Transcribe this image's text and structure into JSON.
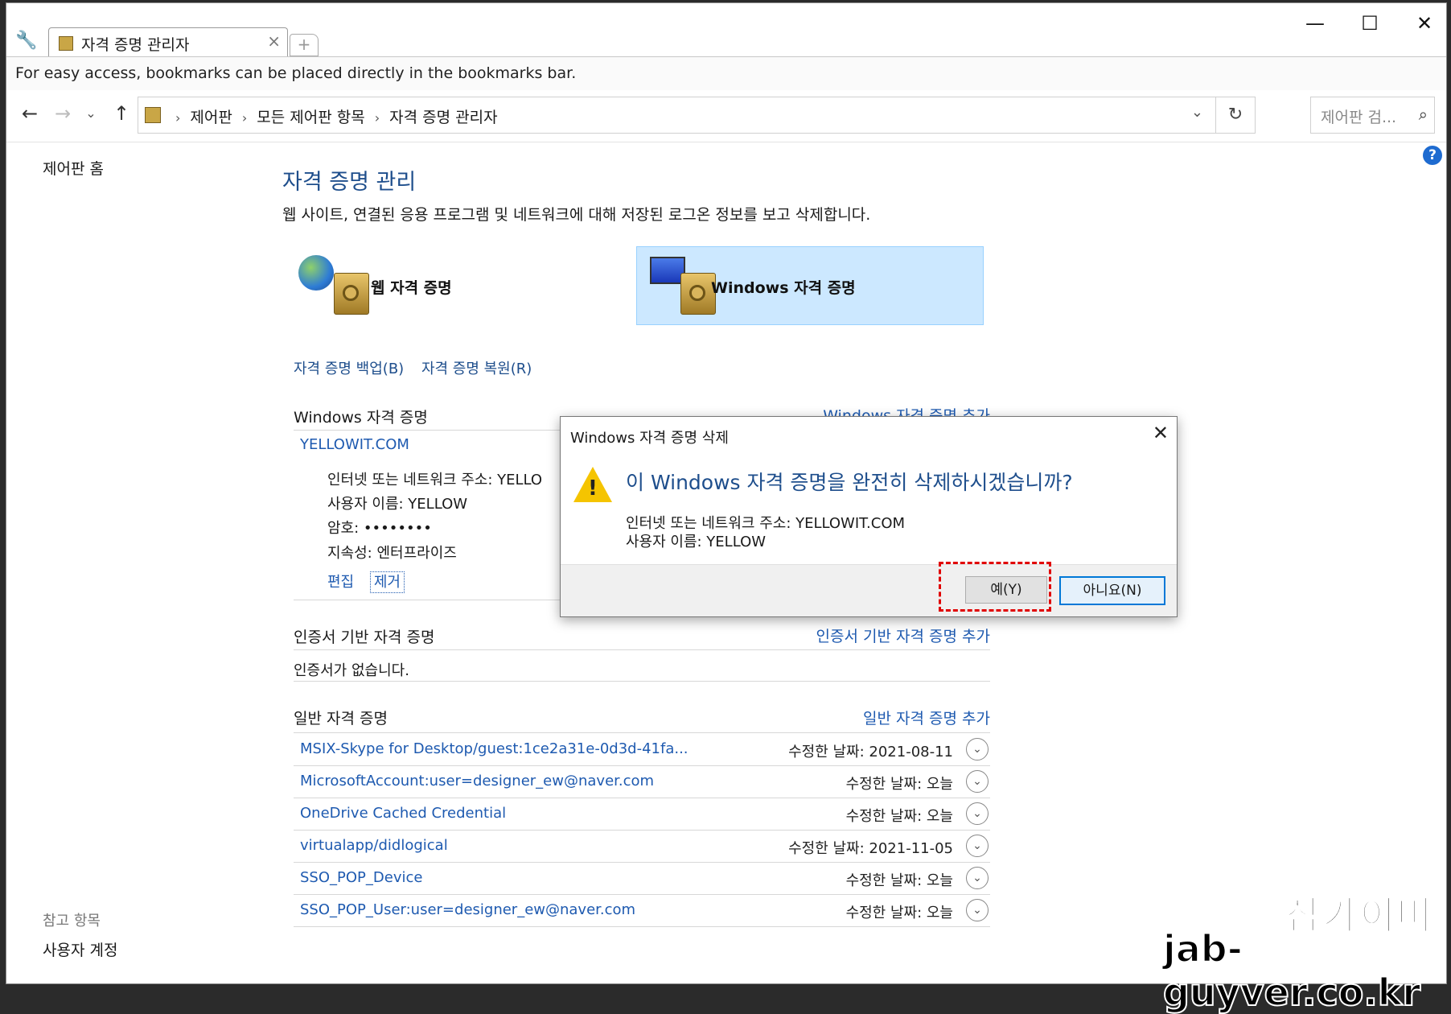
{
  "tab": {
    "title": "자격 증명 관리자"
  },
  "bookmarks_bar": {
    "text": "For easy access, bookmarks can be placed directly in the bookmarks bar."
  },
  "address": {
    "crumbs": [
      "제어판",
      "모든 제어판 항목",
      "자격 증명 관리자"
    ],
    "search_placeholder": "제어판 검..."
  },
  "left_pane": {
    "home": "제어판 홈",
    "see_also": "참고 항목",
    "user_accounts": "사용자 계정"
  },
  "main": {
    "title": "자격 증명 관리",
    "description": "웹 사이트, 연결된 응용 프로그램 및 네트워크에 대해 저장된 로그온 정보를 보고 삭제합니다.",
    "web_credentials_label": "웹 자격 증명",
    "windows_credentials_label": "Windows 자격 증명",
    "backup_link": "자격 증명 백업(B)",
    "restore_link": "자격 증명 복원(R)"
  },
  "windows_section": {
    "title": "Windows 자격 증명",
    "add_link": "Windows 자격 증명 추가",
    "entry": {
      "name": "YELLOWIT.COM",
      "address": "인터넷 또는 네트워크 주소:  YELLO",
      "user": "사용자 이름:  YELLOW",
      "password": "암호:  ••••••••",
      "persistence": "지속성:  엔터프라이즈",
      "edit": "편집",
      "remove": "제거"
    }
  },
  "cert_section": {
    "title": "인증서 기반 자격 증명",
    "add_link": "인증서 기반 자격 증명 추가",
    "empty": "인증서가 없습니다."
  },
  "generic_section": {
    "title": "일반 자격 증명",
    "add_link": "일반 자격 증명 추가",
    "rows": [
      {
        "name": "MSIX-Skype for Desktop/guest:1ce2a31e-0d3d-41fa...",
        "date": "수정한 날짜:  2021-08-11"
      },
      {
        "name": "MicrosoftAccount:user=designer_ew@naver.com",
        "date": "수정한 날짜:  오늘"
      },
      {
        "name": "OneDrive Cached Credential",
        "date": "수정한 날짜:  오늘"
      },
      {
        "name": "virtualapp/didlogical",
        "date": "수정한 날짜:  2021-11-05"
      },
      {
        "name": "SSO_POP_Device",
        "date": "수정한 날짜:  오늘"
      },
      {
        "name": "SSO_POP_User:user=designer_ew@naver.com",
        "date": "수정한 날짜:  오늘"
      }
    ]
  },
  "dialog": {
    "title": "Windows 자격 증명 삭제",
    "question": "이 Windows 자격 증명을 완전히 삭제하시겠습니까?",
    "detail_address": "인터넷 또는 네트워크 주소: YELLOWIT.COM",
    "detail_user": "사용자 이름: YELLOW",
    "yes": "예(Y)",
    "no": "아니요(N)"
  },
  "watermark": {
    "korean": "잡가이버",
    "url": "jab-guyver.co.kr"
  }
}
